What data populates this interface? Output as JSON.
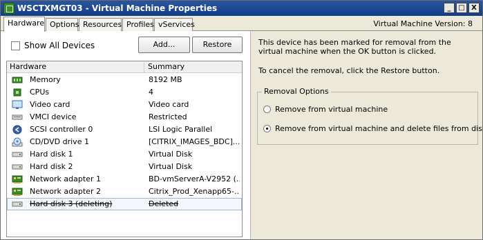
{
  "window": {
    "title": "WSCTXMGT03 - Virtual Machine Properties",
    "controls": {
      "minimize": "_",
      "maximize": "□",
      "close": "X"
    }
  },
  "tabs": [
    "Hardware",
    "Options",
    "Resources",
    "Profiles",
    "vServices"
  ],
  "active_tab": "Hardware",
  "vm_version": "Virtual Machine Version: 8",
  "left": {
    "show_all_devices_label": "Show All Devices",
    "show_all_devices_checked": false,
    "add_button": "Add...",
    "restore_button": "Restore"
  },
  "table": {
    "columns": [
      "Hardware",
      "Summary"
    ],
    "rows": [
      {
        "name": "Memory",
        "summary": "8192 MB",
        "icon": "memory-icon",
        "icon_color": "#3a8a2a"
      },
      {
        "name": "CPUs",
        "summary": "4",
        "icon": "cpu-icon",
        "icon_color": "#3a8a2a"
      },
      {
        "name": "Video card",
        "summary": "Video card",
        "icon": "video-card-icon",
        "icon_color": "#2e6db5"
      },
      {
        "name": "VMCI device",
        "summary": "Restricted",
        "icon": "vmci-device-icon",
        "icon_color": "#8a8a8a"
      },
      {
        "name": "SCSI controller 0",
        "summary": "LSI Logic Parallel",
        "icon": "scsi-controller-icon",
        "icon_color": "#3a5fb0"
      },
      {
        "name": "CD/DVD drive 1",
        "summary": "[CITRIX_IMAGES_BDC]...",
        "icon": "cd-dvd-drive-icon",
        "icon_color": "#4a7cc0"
      },
      {
        "name": "Hard disk 1",
        "summary": "Virtual Disk",
        "icon": "hard-disk-icon",
        "icon_color": "#8a8a8a"
      },
      {
        "name": "Hard disk 2",
        "summary": "Virtual Disk",
        "icon": "hard-disk-icon",
        "icon_color": "#8a8a8a"
      },
      {
        "name": "Network adapter 1",
        "summary": "BD-vmServerA-V2952 (...",
        "icon": "network-adapter-icon",
        "icon_color": "#3a8a2a"
      },
      {
        "name": "Network adapter 2",
        "summary": "Citrix_Prod_Xenapp65-...",
        "icon": "network-adapter-icon",
        "icon_color": "#3a8a2a"
      },
      {
        "name": "Hard disk 3 (deleting)",
        "summary": "Deleted",
        "icon": "hard-disk-icon",
        "icon_color": "#8a8a8a",
        "deleting": true
      }
    ]
  },
  "right": {
    "message_removal": "This device has been marked for removal from the virtual machine when the OK button is clicked.",
    "message_cancel": "To cancel the removal, click the Restore button.",
    "group_title": "Removal Options",
    "options": [
      {
        "label": "Remove from virtual machine",
        "selected": false
      },
      {
        "label": "Remove from virtual machine and delete files from disk",
        "selected": true
      }
    ]
  }
}
